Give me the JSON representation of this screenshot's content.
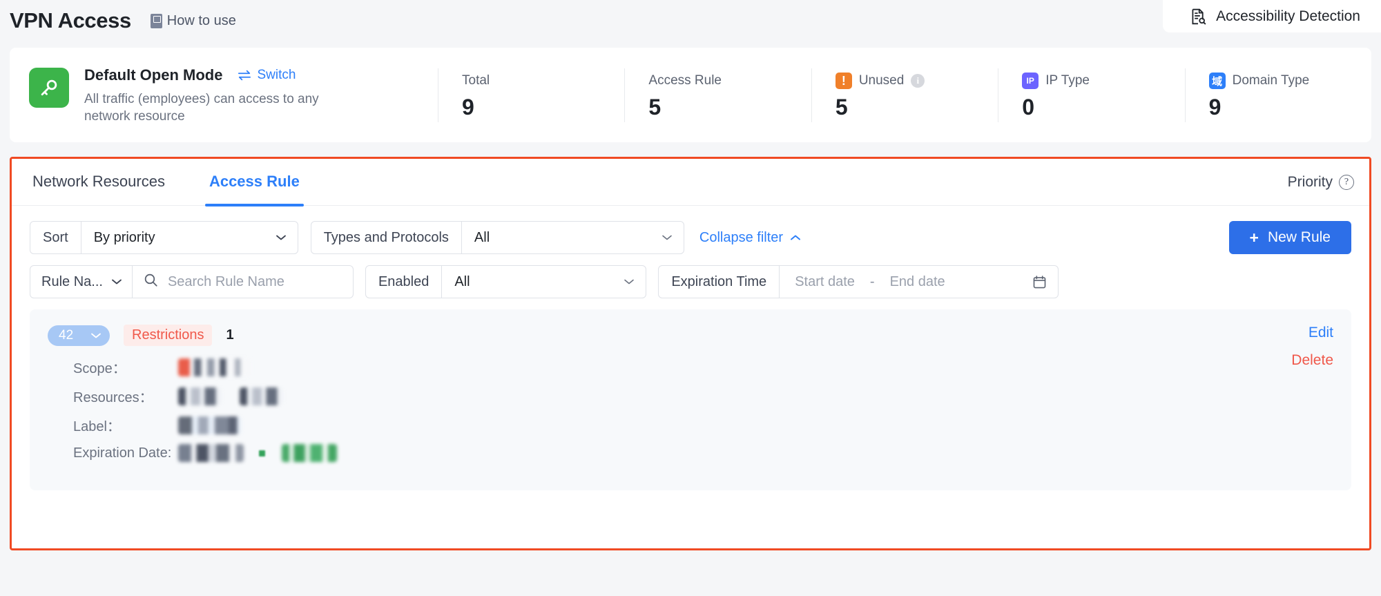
{
  "header": {
    "title": "VPN Access",
    "how_to_use": "How to use",
    "book_icon": "book-icon",
    "accessibility": {
      "label": "Accessibility Detection",
      "icon": "document-search-icon"
    }
  },
  "summary": {
    "mode": {
      "icon": "key-icon",
      "icon_color": "#3cb44a",
      "title": "Default Open Mode",
      "switch_label": "Switch",
      "switch_icon": "swap-arrows-icon",
      "description": "All traffic (employees) can access to any network resource"
    },
    "stats": [
      {
        "label": "Total",
        "value": "9",
        "icon": null
      },
      {
        "label": "Access Rule",
        "value": "5",
        "icon": null
      },
      {
        "label": "Unused",
        "value": "5",
        "icon": "warning-exclamation-icon",
        "icon_text": "!",
        "icon_color": "#f0802a",
        "has_info": true,
        "info_icon": "info-icon"
      },
      {
        "label": "IP Type",
        "value": "0",
        "icon": "ip-badge-icon",
        "icon_text": "IP",
        "icon_color": "#6c63ff"
      },
      {
        "label": "Domain Type",
        "value": "9",
        "icon": "domain-badge-icon",
        "icon_text": "域",
        "icon_color": "#2d7ff9"
      }
    ]
  },
  "panel": {
    "tabs": [
      {
        "label": "Network Resources",
        "active": false
      },
      {
        "label": "Access Rule",
        "active": true
      }
    ],
    "priority": {
      "label": "Priority",
      "help_icon": "question-circle-icon",
      "help_text": "?"
    },
    "filters": {
      "sort": {
        "label": "Sort",
        "value": "By priority",
        "chevron": "chevron-down-icon"
      },
      "types": {
        "label": "Types and Protocols",
        "value": "All",
        "chevron": "chevron-down-icon"
      },
      "collapse": {
        "label": "Collapse filter",
        "chevron": "chevron-up-icon"
      },
      "new_rule": {
        "label": "New Rule",
        "plus": "+"
      },
      "rule_name": {
        "label": "Rule Na...",
        "chevron": "chevron-down-icon",
        "placeholder": "Search Rule Name",
        "value": "",
        "search_icon": "search-icon"
      },
      "enabled": {
        "label": "Enabled",
        "value": "All",
        "chevron": "chevron-down-icon"
      },
      "expiration": {
        "label": "Expiration Time",
        "start_placeholder": "Start date",
        "separator": "-",
        "end_placeholder": "End date",
        "calendar_icon": "calendar-icon"
      }
    },
    "rule": {
      "priority_badge": "42",
      "priority_chevron": "chevron-down-icon",
      "restrictions_tag": "Restrictions",
      "rule_number": "1",
      "fields": [
        {
          "key": "Scope："
        },
        {
          "key": "Resources："
        },
        {
          "key": "Label："
        },
        {
          "key": "Expiration Date:"
        }
      ],
      "actions": {
        "edit": "Edit",
        "delete": "Delete"
      }
    }
  },
  "colors": {
    "accent_blue": "#2d7ff9",
    "button_blue": "#2d6fe8",
    "highlight_outline": "#f04a23",
    "danger_red": "#f0584a",
    "green": "#3cb44a",
    "orange": "#f0802a",
    "purple": "#6c63ff"
  }
}
